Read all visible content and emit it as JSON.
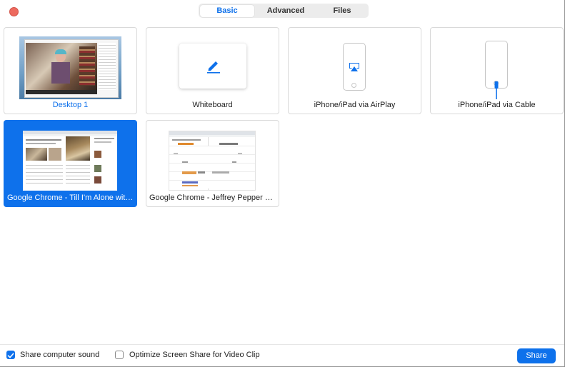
{
  "tabs": [
    {
      "label": "Basic",
      "active": true
    },
    {
      "label": "Advanced",
      "active": false
    },
    {
      "label": "Files",
      "active": false
    }
  ],
  "tiles": [
    {
      "label": "Desktop 1",
      "selected": false
    },
    {
      "label": "Whiteboard",
      "selected": false
    },
    {
      "label": "iPhone/iPad via AirPlay",
      "selected": false
    },
    {
      "label": "iPhone/iPad via Cable",
      "selected": false
    },
    {
      "label": "Google Chrome - Till I'm Alone with You by Jeffrey Pepper",
      "selected": true
    },
    {
      "label": "Google Chrome - Jeffrey Pepper Recording Calendar",
      "selected": false
    }
  ],
  "footer": {
    "share_sound_label": "Share computer sound",
    "share_sound_checked": true,
    "optimize_label": "Optimize Screen Share for Video Clip",
    "optimize_checked": false,
    "share_button_label": "Share"
  },
  "colors": {
    "accent": "#0e71eb",
    "close_button": "#ed6a5e"
  }
}
